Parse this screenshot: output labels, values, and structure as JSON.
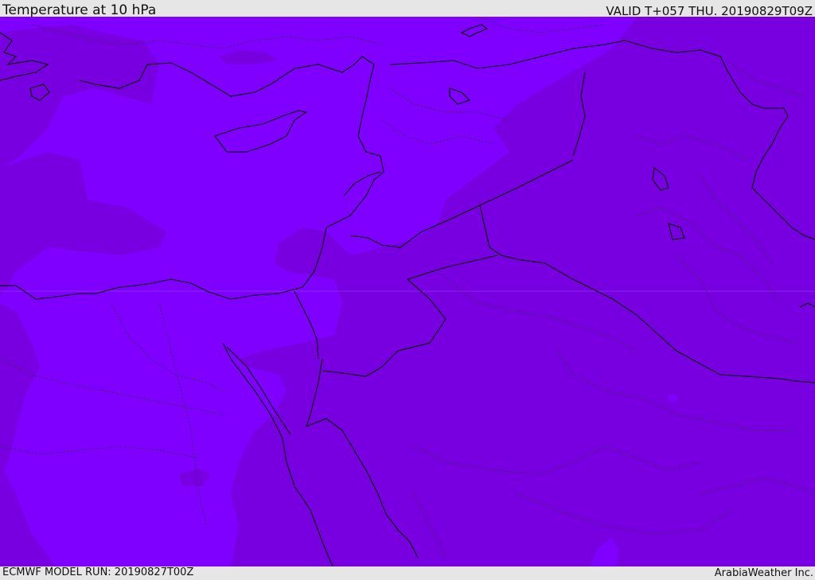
{
  "header": {
    "title": "Temperature at 10 hPa",
    "valid_time": "VALID T+057 THU. 20190829T09Z"
  },
  "footer": {
    "model_run": "ECMWF MODEL RUN: 20190827T00Z",
    "credit": "ArabiaWeather Inc."
  },
  "map": {
    "colors": {
      "warm_region": "#7800e0",
      "cool_region": "#7f00ff",
      "coastline": "#000000",
      "internal_border": "#333344"
    }
  }
}
